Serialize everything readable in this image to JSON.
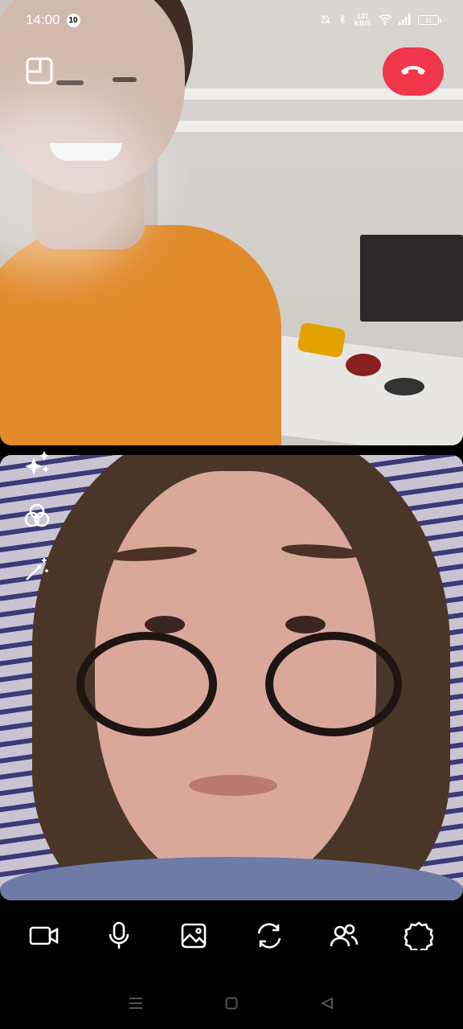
{
  "status_bar": {
    "time": "14:00",
    "notification_count": "10",
    "network_speed_value": "131",
    "network_speed_unit": "KB/S",
    "battery": "31",
    "icons": [
      "mute-icon",
      "bluetooth-icon",
      "wifi-icon",
      "signal-icon",
      "battery-icon"
    ]
  },
  "call_controls": {
    "icons": [
      "picture-in-picture-icon",
      "end-call-icon"
    ],
    "end_call_color": "#f2364b"
  },
  "effects_toolbar": {
    "icons": [
      "sparkles-icon",
      "filters-icon",
      "magic-wand-icon"
    ]
  },
  "bottom_toolbar": {
    "icons": [
      "camera-icon",
      "microphone-icon",
      "image-icon",
      "switch-camera-icon",
      "participants-icon",
      "settings-icon"
    ]
  },
  "nav_bar": {
    "icons": [
      "menu-icon",
      "home-icon",
      "back-icon"
    ]
  }
}
